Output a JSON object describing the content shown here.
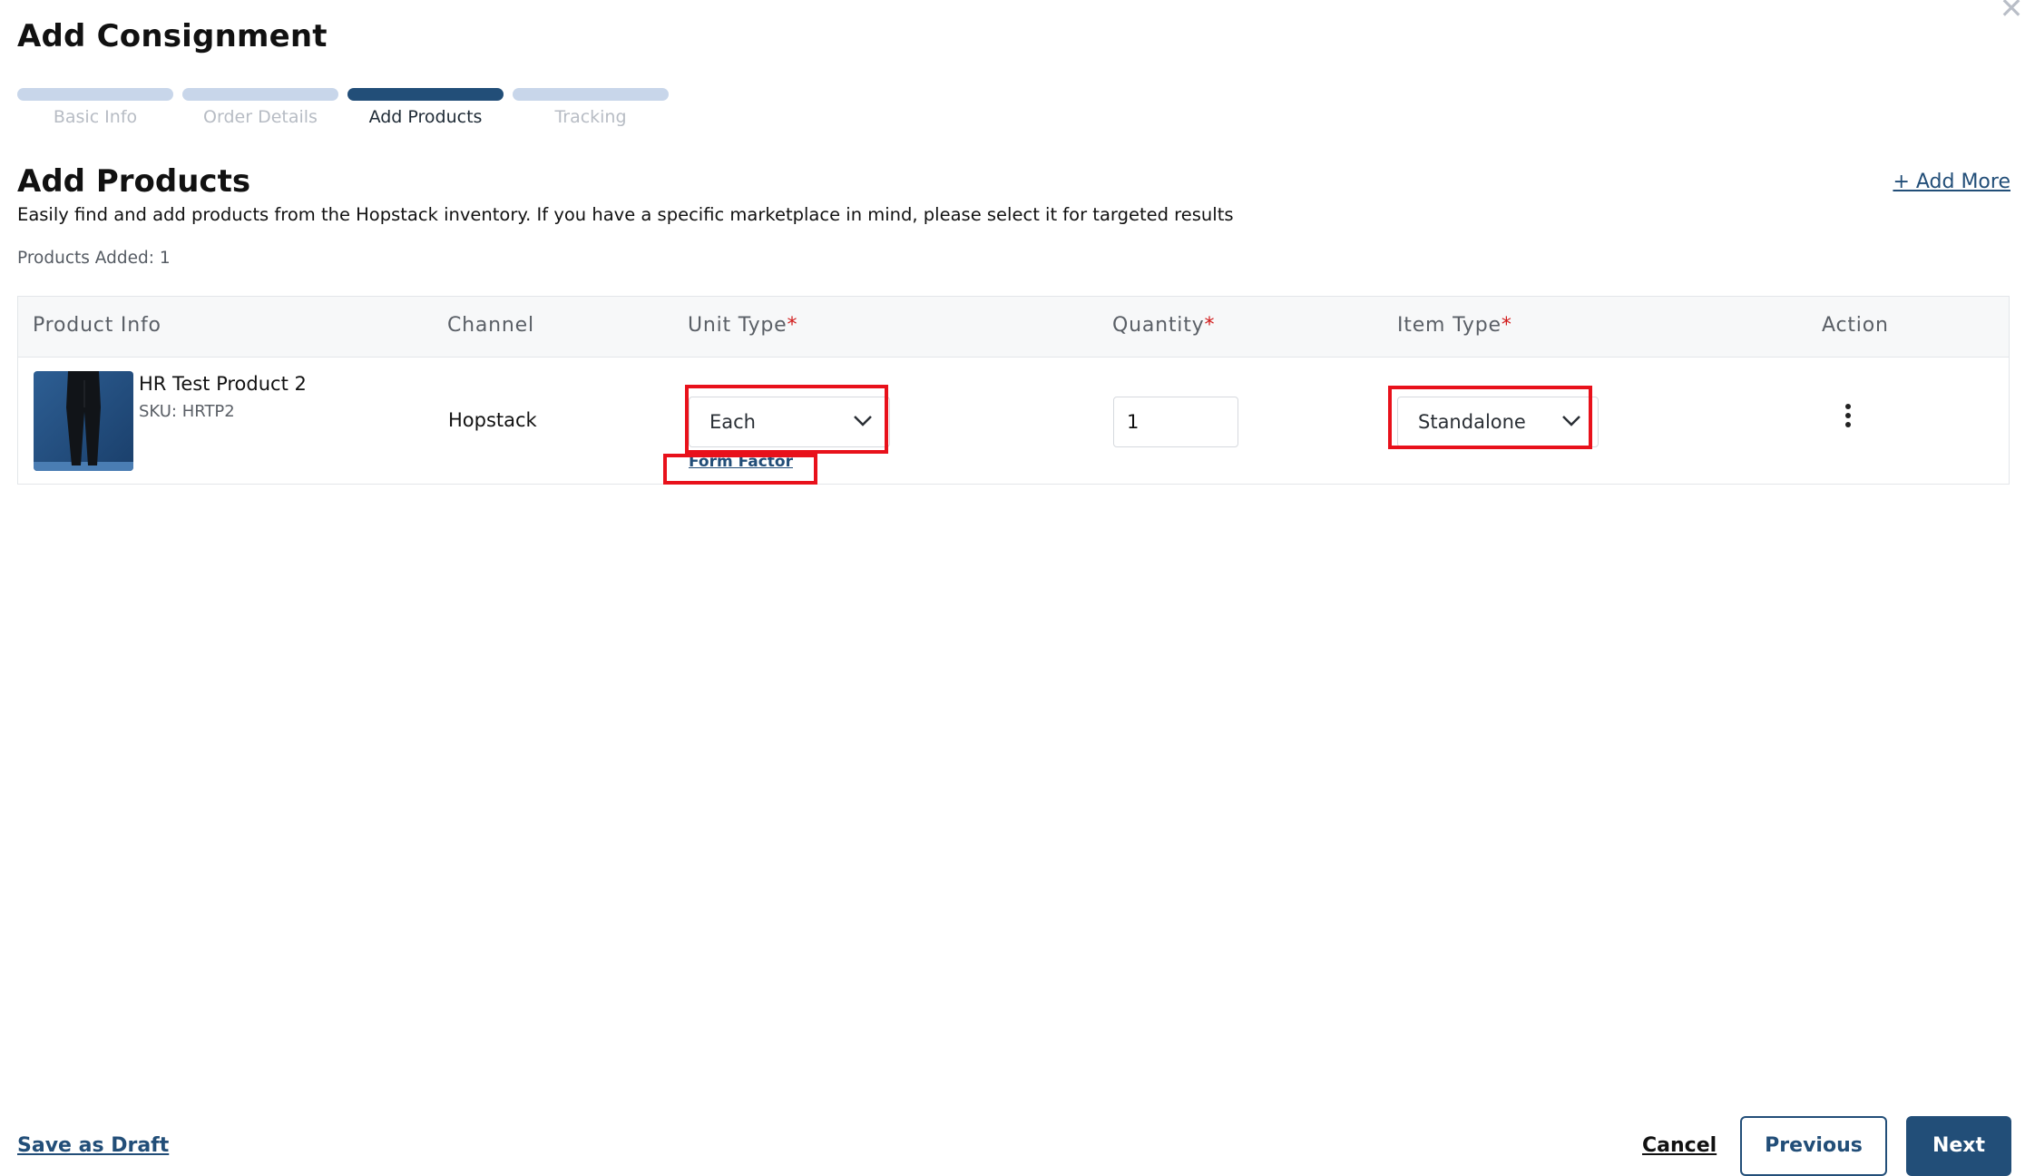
{
  "header": {
    "title": "Add Consignment",
    "close_icon": "close-icon"
  },
  "stepper": {
    "steps": [
      {
        "label": "Basic Info",
        "state": "completed"
      },
      {
        "label": "Order Details",
        "state": "completed"
      },
      {
        "label": "Add Products",
        "state": "active"
      },
      {
        "label": "Tracking",
        "state": "upcoming"
      }
    ]
  },
  "section": {
    "title": "Add Products",
    "description": "Easily find and add products from the Hopstack inventory. If you have a specific marketplace in mind, please select it for targeted results",
    "add_more": "+ Add More",
    "products_added": "Products Added: 1"
  },
  "table": {
    "headers": {
      "product_info": "Product Info",
      "channel": "Channel",
      "unit_type": "Unit Type",
      "quantity": "Quantity",
      "item_type": "Item Type",
      "action": "Action",
      "required_mark": "*"
    },
    "rows": [
      {
        "name": "HR Test Product 2",
        "sku": "SKU: HRTP2",
        "channel": "Hopstack",
        "unit_type": "Each",
        "form_factor": "Form Factor",
        "quantity": "1",
        "item_type": "Standalone",
        "action_icon": "kebab-menu-icon"
      }
    ]
  },
  "footer": {
    "save_draft": "Save as Draft",
    "cancel": "Cancel",
    "previous": "Previous",
    "next": "Next"
  },
  "colors": {
    "primary": "#224e78",
    "step_inactive": "#c8d6ea",
    "required": "#d11a1a",
    "highlight": "#e8111b"
  }
}
